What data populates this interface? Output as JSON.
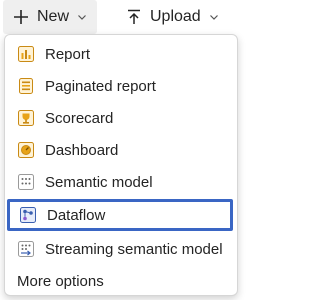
{
  "toolbar": {
    "new_label": "New",
    "upload_label": "Upload"
  },
  "menu": {
    "items": [
      {
        "label": "Report",
        "icon": "report-icon"
      },
      {
        "label": "Paginated report",
        "icon": "paginated-report-icon"
      },
      {
        "label": "Scorecard",
        "icon": "scorecard-icon"
      },
      {
        "label": "Dashboard",
        "icon": "dashboard-icon"
      },
      {
        "label": "Semantic model",
        "icon": "semantic-model-icon"
      },
      {
        "label": "Dataflow",
        "icon": "dataflow-icon"
      },
      {
        "label": "Streaming semantic model",
        "icon": "streaming-semantic-model-icon"
      }
    ],
    "more_label": "More options",
    "selected_item": "Dataflow"
  },
  "colors": {
    "selection_border": "#3a66c4",
    "powerbi_yellow": "#e8a317",
    "dataflow_blue": "#3a5fb0"
  }
}
